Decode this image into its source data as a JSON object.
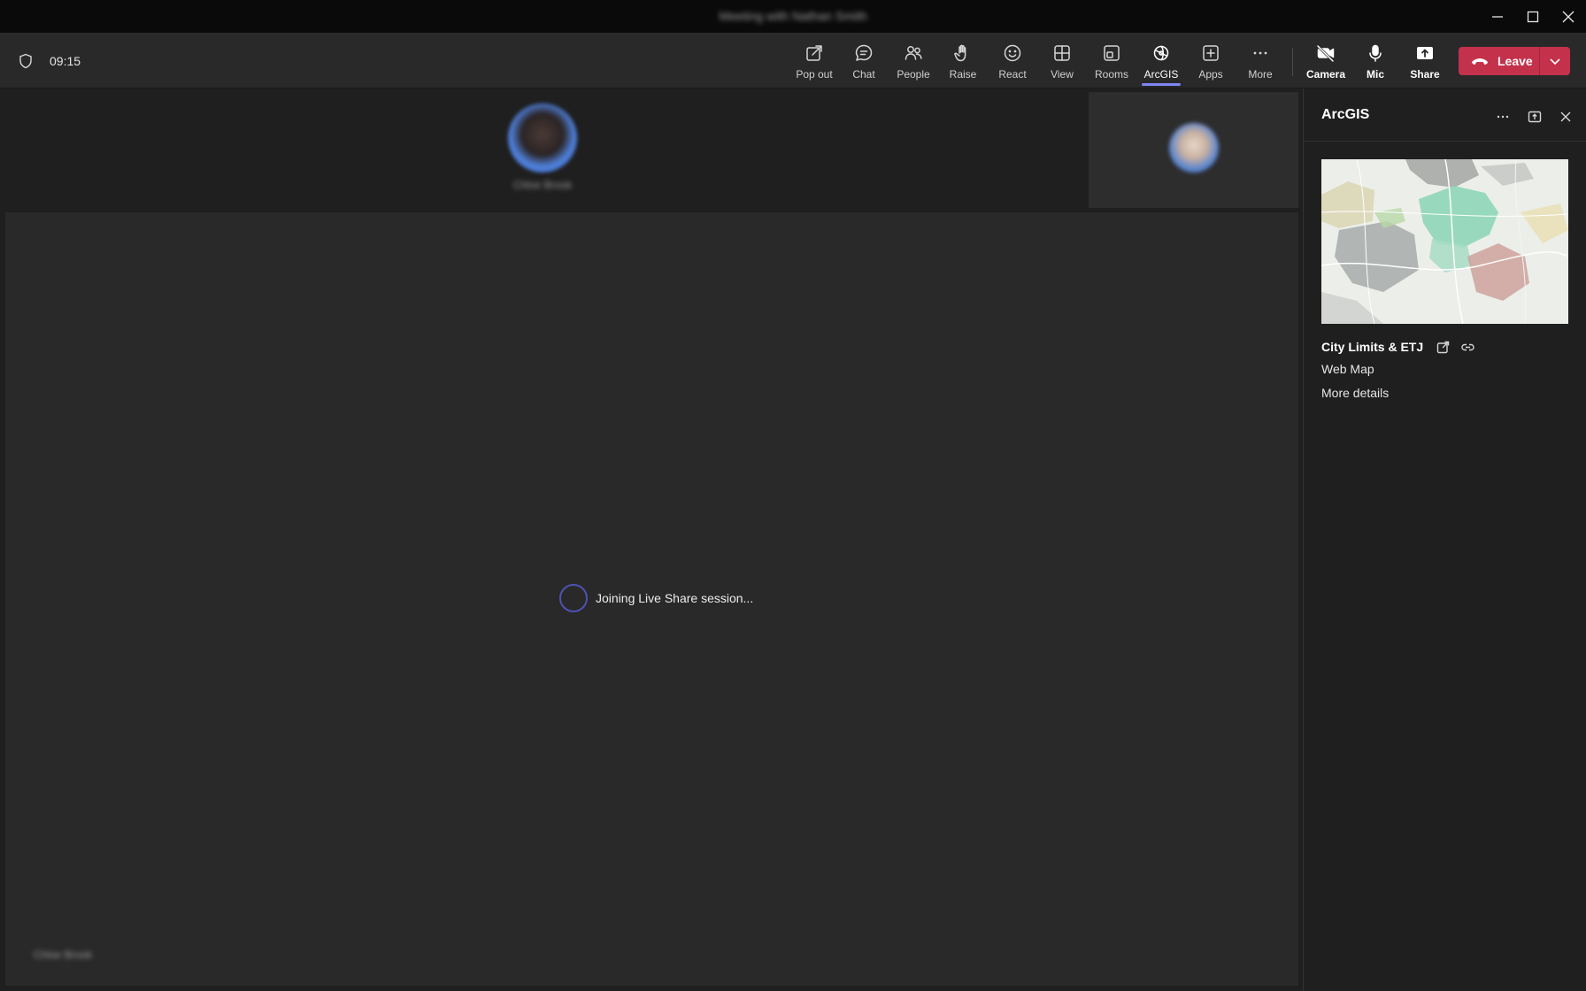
{
  "window": {
    "title": "Meeting with Nathan Smith",
    "minimize_icon": "minimize-icon",
    "maximize_icon": "maximize-icon",
    "close_icon": "close-icon"
  },
  "toolbar": {
    "timer": "09:15",
    "buttons": [
      {
        "label": "Pop out",
        "icon": "pop-out-icon"
      },
      {
        "label": "Chat",
        "icon": "chat-icon"
      },
      {
        "label": "People",
        "icon": "people-icon"
      },
      {
        "label": "Raise",
        "icon": "raise-hand-icon"
      },
      {
        "label": "React",
        "icon": "react-icon"
      },
      {
        "label": "View",
        "icon": "view-icon"
      },
      {
        "label": "Rooms",
        "icon": "rooms-icon"
      },
      {
        "label": "ArcGIS",
        "icon": "arcgis-icon",
        "active": true
      },
      {
        "label": "Apps",
        "icon": "apps-icon"
      },
      {
        "label": "More",
        "icon": "more-icon"
      }
    ],
    "camera_label": "Camera",
    "mic_label": "Mic",
    "share_label": "Share",
    "leave_label": "Leave",
    "accent_color": "#7f85f5",
    "leave_color": "#c4314b"
  },
  "stage": {
    "participant_name": "Chloe Brook",
    "presenter_name": "Chloe Brook",
    "loading_text": "Joining Live Share session..."
  },
  "panel": {
    "title": "ArcGIS",
    "item_title": "City Limits & ETJ",
    "item_type": "Web Map",
    "more_details": "More details"
  }
}
